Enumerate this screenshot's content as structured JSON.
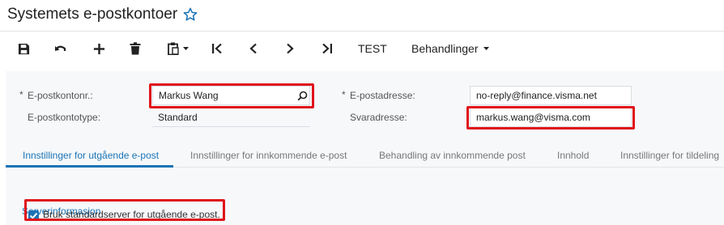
{
  "header": {
    "title": "Systemets e-postkontoer",
    "favorite_icon": "star-outline-icon"
  },
  "toolbar": {
    "buttons": [
      {
        "name": "save-button",
        "icon": "save-icon"
      },
      {
        "name": "undo-button",
        "icon": "undo-icon"
      },
      {
        "name": "add-button",
        "icon": "plus-icon"
      },
      {
        "name": "delete-button",
        "icon": "trash-icon"
      },
      {
        "name": "copy-paste-button",
        "icon": "clipboard-icon"
      },
      {
        "name": "first-record-button",
        "icon": "first-icon"
      },
      {
        "name": "previous-record-button",
        "icon": "chevron-left-icon"
      },
      {
        "name": "next-record-button",
        "icon": "chevron-right-icon"
      },
      {
        "name": "last-record-button",
        "icon": "last-icon"
      }
    ],
    "test_label": "TEST",
    "actions_label": "Behandlinger"
  },
  "form": {
    "account_no": {
      "label": "E-postkontonr.:",
      "value": "Markus Wang"
    },
    "account_type": {
      "label": "E-postkontotype:",
      "value": "Standard"
    },
    "email": {
      "label": "E-postadresse:",
      "value": "no-reply@finance.visma.net"
    },
    "reply": {
      "label": "Svaradresse:",
      "value": "markus.wang@visma.com"
    },
    "required_marker": "*"
  },
  "tabs": [
    {
      "label": "Innstillinger for utgående e-post",
      "active": true
    },
    {
      "label": "Innstillinger for innkommende e-post",
      "active": false
    },
    {
      "label": "Behandling av innkommende post",
      "active": false
    },
    {
      "label": "Innhold",
      "active": false
    },
    {
      "label": "Innstillinger for tildeling",
      "active": false
    }
  ],
  "section": {
    "title": "Serverinformasjon",
    "use_default_server": {
      "label": "Bruk standardserver for utgående e-post.",
      "checked": true
    }
  },
  "colors": {
    "accent": "#1a73b5",
    "highlight": "#e0141b"
  }
}
